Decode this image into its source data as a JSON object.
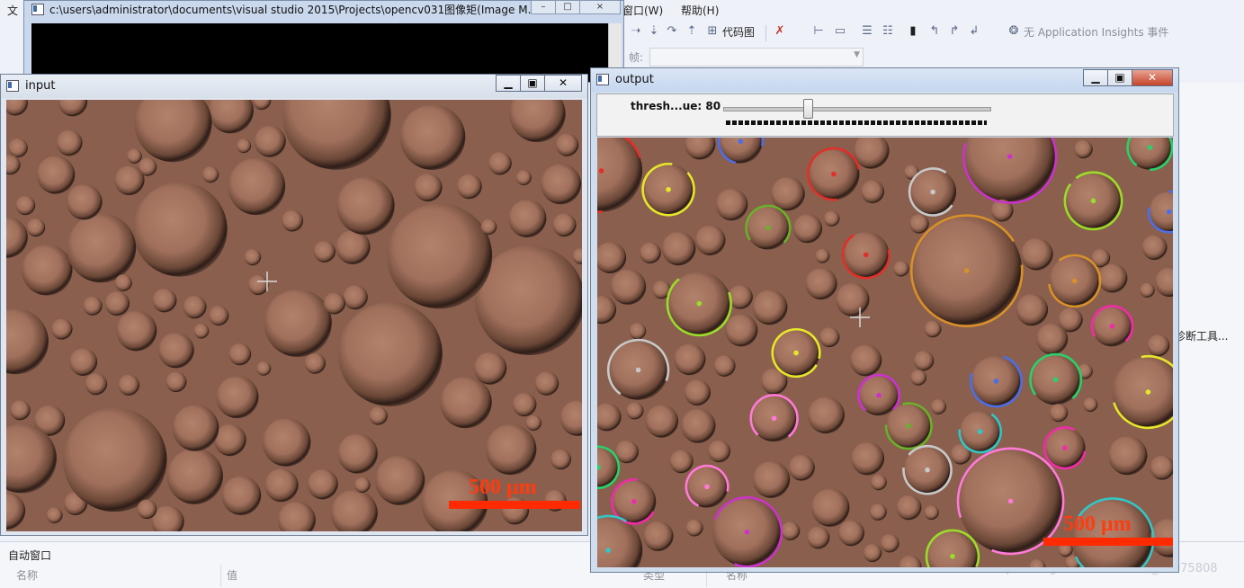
{
  "vs": {
    "menu": {
      "window_partial": "窗口(W)",
      "help": "帮助(H)",
      "file_partial": "文"
    },
    "toolbar": {
      "code_map": "代码图",
      "insights": "无 Application Insights 事件",
      "frame_label": "帧:"
    },
    "right_panel": {
      "diagnostics_partial": "诊断工具..."
    },
    "bottom": {
      "auto_window": "自动窗口",
      "col_name": "名称",
      "col_value": "值",
      "col_type": "类型",
      "col_name2": "名称"
    },
    "watermark": "https://blog.csdn.net/weixin_43075808"
  },
  "console": {
    "title": "c:\\users\\administrator\\documents\\visual studio 2015\\Projects\\opencv031图像矩(Image M..."
  },
  "input_window": {
    "title": "input",
    "scale_text": "500 μm"
  },
  "output_window": {
    "title": "output",
    "trackbar": {
      "label": "thresh...ue: 80",
      "value": 80,
      "max": 255
    },
    "scale_text": "500 μm"
  },
  "colors": {
    "background_tint": "#8a5f4d",
    "scale_bar": "#ff2a00"
  }
}
